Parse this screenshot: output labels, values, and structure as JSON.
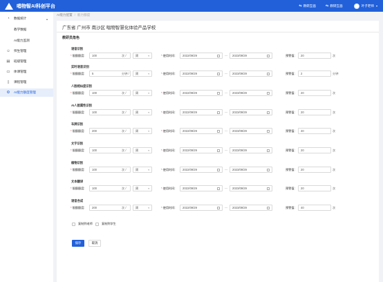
{
  "app": {
    "title": "唱物智AI科创平台"
  },
  "header": {
    "link1": "教研互画",
    "link2": "教研互画",
    "user": "叶子老师"
  },
  "sidebar": {
    "items": [
      {
        "label": "数据统计",
        "icon": "pie-chart-icon"
      },
      {
        "label": "教学数据"
      },
      {
        "label": "AI能力监测"
      },
      {
        "label": "师生管理",
        "icon": "user-icon"
      },
      {
        "label": "班级管理",
        "icon": "class-icon"
      },
      {
        "label": "体课管理",
        "icon": "course-icon"
      },
      {
        "label": "课程管理",
        "icon": "book-icon"
      },
      {
        "label": "AI能力额度管理",
        "icon": "settings-icon"
      }
    ]
  },
  "breadcrumb": {
    "parent": "AI能力配置",
    "current": "能力额度"
  },
  "card": {
    "school": "广东省 广州市 南沙区 唱物智慧化体验产品学校",
    "role": "教研员角色",
    "labels": {
      "quota": "限额额度:",
      "time": "使用时间:",
      "warn": "预警值:"
    },
    "sections": [
      {
        "title": "语音识别",
        "quota": "100",
        "unit": "次 /",
        "period": "周",
        "start": "2022/09/29",
        "end": "2023/09/29",
        "warn": "20",
        "warn_unit": "次"
      },
      {
        "title": "实时语音识别",
        "quota": "5",
        "unit": "分钟 /",
        "period": "周",
        "start": "2022/09/29",
        "end": "2023/09/29",
        "warn": "2",
        "warn_unit": "分钟"
      },
      {
        "title": "人脸相似度识别",
        "quota": "100",
        "unit": "次 /",
        "period": "周",
        "start": "2022/09/29",
        "end": "2023/09/29",
        "warn": "20",
        "warn_unit": "次"
      },
      {
        "title": "AI人脸属性识别",
        "quota": "100",
        "unit": "次 /",
        "period": "周",
        "start": "2022/09/29",
        "end": "2023/09/29",
        "warn": "20",
        "warn_unit": "次"
      },
      {
        "title": "车牌识别",
        "quota": "200",
        "unit": "次 /",
        "period": "周",
        "start": "2022/09/29",
        "end": "2023/09/29",
        "warn": "40",
        "warn_unit": "次"
      },
      {
        "title": "文字识别",
        "quota": "100",
        "unit": "次 /",
        "period": "周",
        "start": "2022/09/29",
        "end": "2023/09/29",
        "warn": "20",
        "warn_unit": "次"
      },
      {
        "title": "植物识别",
        "quota": "100",
        "unit": "次 /",
        "period": "周",
        "start": "2022/09/29",
        "end": "2023/09/29",
        "warn": "20",
        "warn_unit": "次"
      },
      {
        "title": "文本翻译",
        "quota": "100",
        "unit": "次 /",
        "period": "周",
        "start": "2022/09/29",
        "end": "2023/09/29",
        "warn": "20",
        "warn_unit": "次"
      },
      {
        "title": "语音合成",
        "quota": "200",
        "unit": "次 /",
        "period": "周",
        "start": "2022/09/29",
        "end": "2023/09/29",
        "warn": "40",
        "warn_unit": "次"
      }
    ],
    "check1": "复制到老师",
    "check2": "复制到学生",
    "save": "保存",
    "cancel": "取消"
  },
  "colors": {
    "primary": "#2160d9",
    "required": "#e5484d",
    "active_bg": "#e6eefc"
  }
}
